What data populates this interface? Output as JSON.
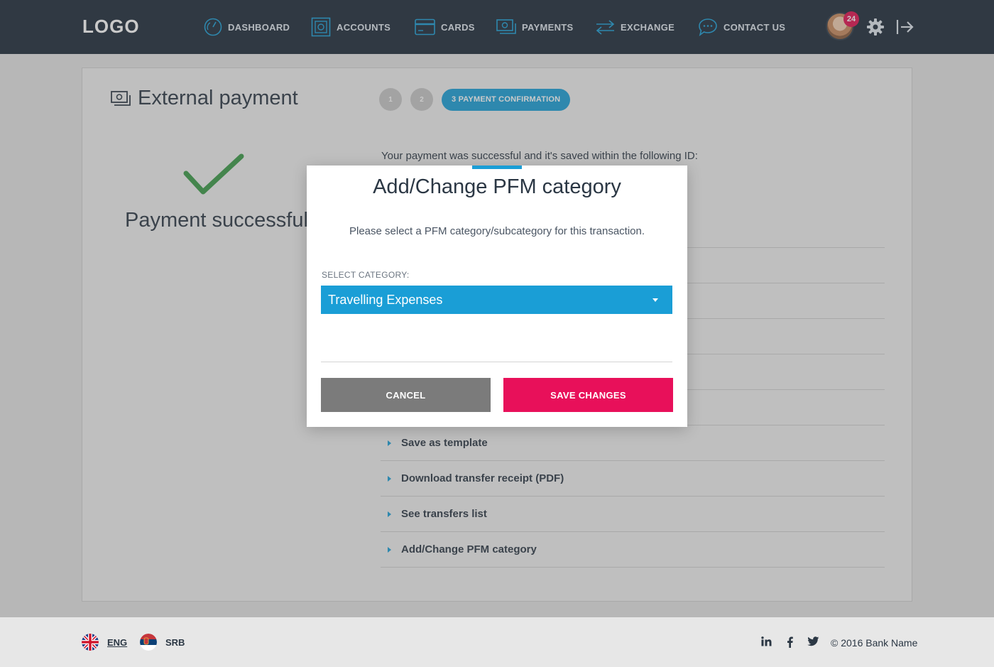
{
  "nav": {
    "logo": "LOGO",
    "items": [
      {
        "label": "DASHBOARD",
        "icon": "dashboard-icon"
      },
      {
        "label": "ACCOUNTS",
        "icon": "accounts-icon"
      },
      {
        "label": "CARDS",
        "icon": "card-icon"
      },
      {
        "label": "PAYMENTS",
        "icon": "payments-icon"
      },
      {
        "label": "EXCHANGE",
        "icon": "exchange-icon"
      },
      {
        "label": "CONTACT US",
        "icon": "chat-icon"
      }
    ],
    "notification_count": "24"
  },
  "page": {
    "title": "External payment",
    "steps": [
      "1",
      "2"
    ],
    "active_step": "3 PAYMENT CONFIRMATION",
    "success_text": "Payment successful",
    "result_text": "Your payment was successful and it's saved within the following ID:",
    "actions": [
      "Save as template",
      "Download transfer receipt (PDF)",
      "See transfers list",
      "Add/Change PFM category"
    ]
  },
  "modal": {
    "title": "Add/Change PFM category",
    "description": "Please select a PFM category/subcategory for this transaction.",
    "select_label": "SELECT CATEGORY:",
    "selected_value": "Travelling Expenses",
    "cancel_label": "CANCEL",
    "save_label": "SAVE CHANGES"
  },
  "footer": {
    "languages": [
      {
        "label": "ENG",
        "active": true
      },
      {
        "label": "SRB",
        "active": false
      }
    ],
    "copyright": "© 2016 Bank Name"
  },
  "colors": {
    "nav_bg": "#1d2a38",
    "accent": "#1a9ed6",
    "primary_button": "#e8105a",
    "secondary_button": "#7b7b7b",
    "success": "#3a9a47"
  }
}
